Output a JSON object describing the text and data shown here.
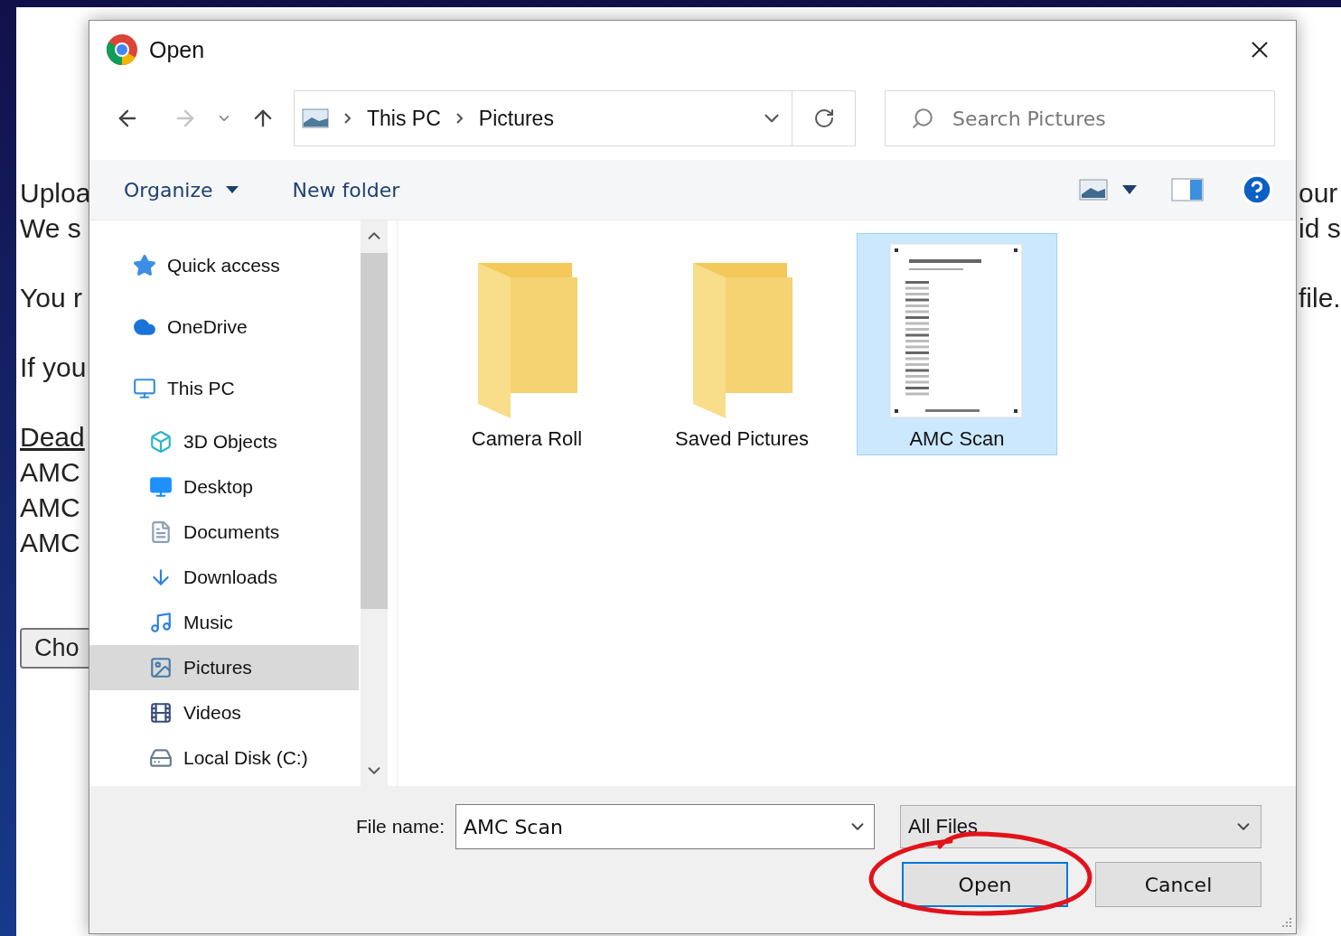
{
  "background_page": {
    "left_paragraphs": [
      [
        {
          "text": "Uploa",
          "kind": "text"
        },
        {
          "text": "We s",
          "kind": "text"
        }
      ],
      [
        {
          "text": "You r",
          "kind": "text"
        }
      ],
      [
        {
          "text": "If you",
          "kind": "text"
        }
      ],
      [
        {
          "text": "Dead",
          "kind": "link"
        },
        {
          "text": "AMC",
          "kind": "text"
        },
        {
          "text": "AMC",
          "kind": "text"
        },
        {
          "text": "AMC",
          "kind": "text"
        }
      ]
    ],
    "choose_button": "Cho",
    "right_paragraphs": [
      [
        "our",
        "id s"
      ],
      [
        "file."
      ]
    ]
  },
  "dialog": {
    "title": "Open",
    "nav": {
      "back_disabled": false,
      "forward_disabled": true
    },
    "breadcrumb": [
      "This PC",
      "Pictures"
    ],
    "search": {
      "placeholder": "Search Pictures"
    },
    "toolbar": {
      "organize": "Organize",
      "new_folder": "New folder"
    },
    "sidebar": {
      "items": [
        {
          "label": "Quick access",
          "kind": "star",
          "selected": false
        },
        {
          "label": "OneDrive",
          "kind": "cloud",
          "selected": false
        },
        {
          "label": "This PC",
          "kind": "computer",
          "selected": false,
          "children": [
            {
              "label": "3D Objects",
              "kind": "cube",
              "selected": false
            },
            {
              "label": "Desktop",
              "kind": "desktop",
              "selected": false
            },
            {
              "label": "Documents",
              "kind": "document",
              "selected": false
            },
            {
              "label": "Downloads",
              "kind": "download",
              "selected": false
            },
            {
              "label": "Music",
              "kind": "music",
              "selected": false
            },
            {
              "label": "Pictures",
              "kind": "pictures",
              "selected": true
            },
            {
              "label": "Videos",
              "kind": "video",
              "selected": false
            },
            {
              "label": "Local Disk (C:)",
              "kind": "disk",
              "selected": false
            }
          ]
        }
      ]
    },
    "files": [
      {
        "name": "Camera Roll",
        "kind": "folder",
        "selected": false
      },
      {
        "name": "Saved Pictures",
        "kind": "folder",
        "selected": false
      },
      {
        "name": "AMC Scan",
        "kind": "scan",
        "selected": true
      }
    ],
    "file_name": {
      "label": "File name:",
      "value": "AMC Scan"
    },
    "file_type": "All Files",
    "buttons": {
      "open": "Open",
      "cancel": "Cancel"
    },
    "open_button_circled": true
  }
}
